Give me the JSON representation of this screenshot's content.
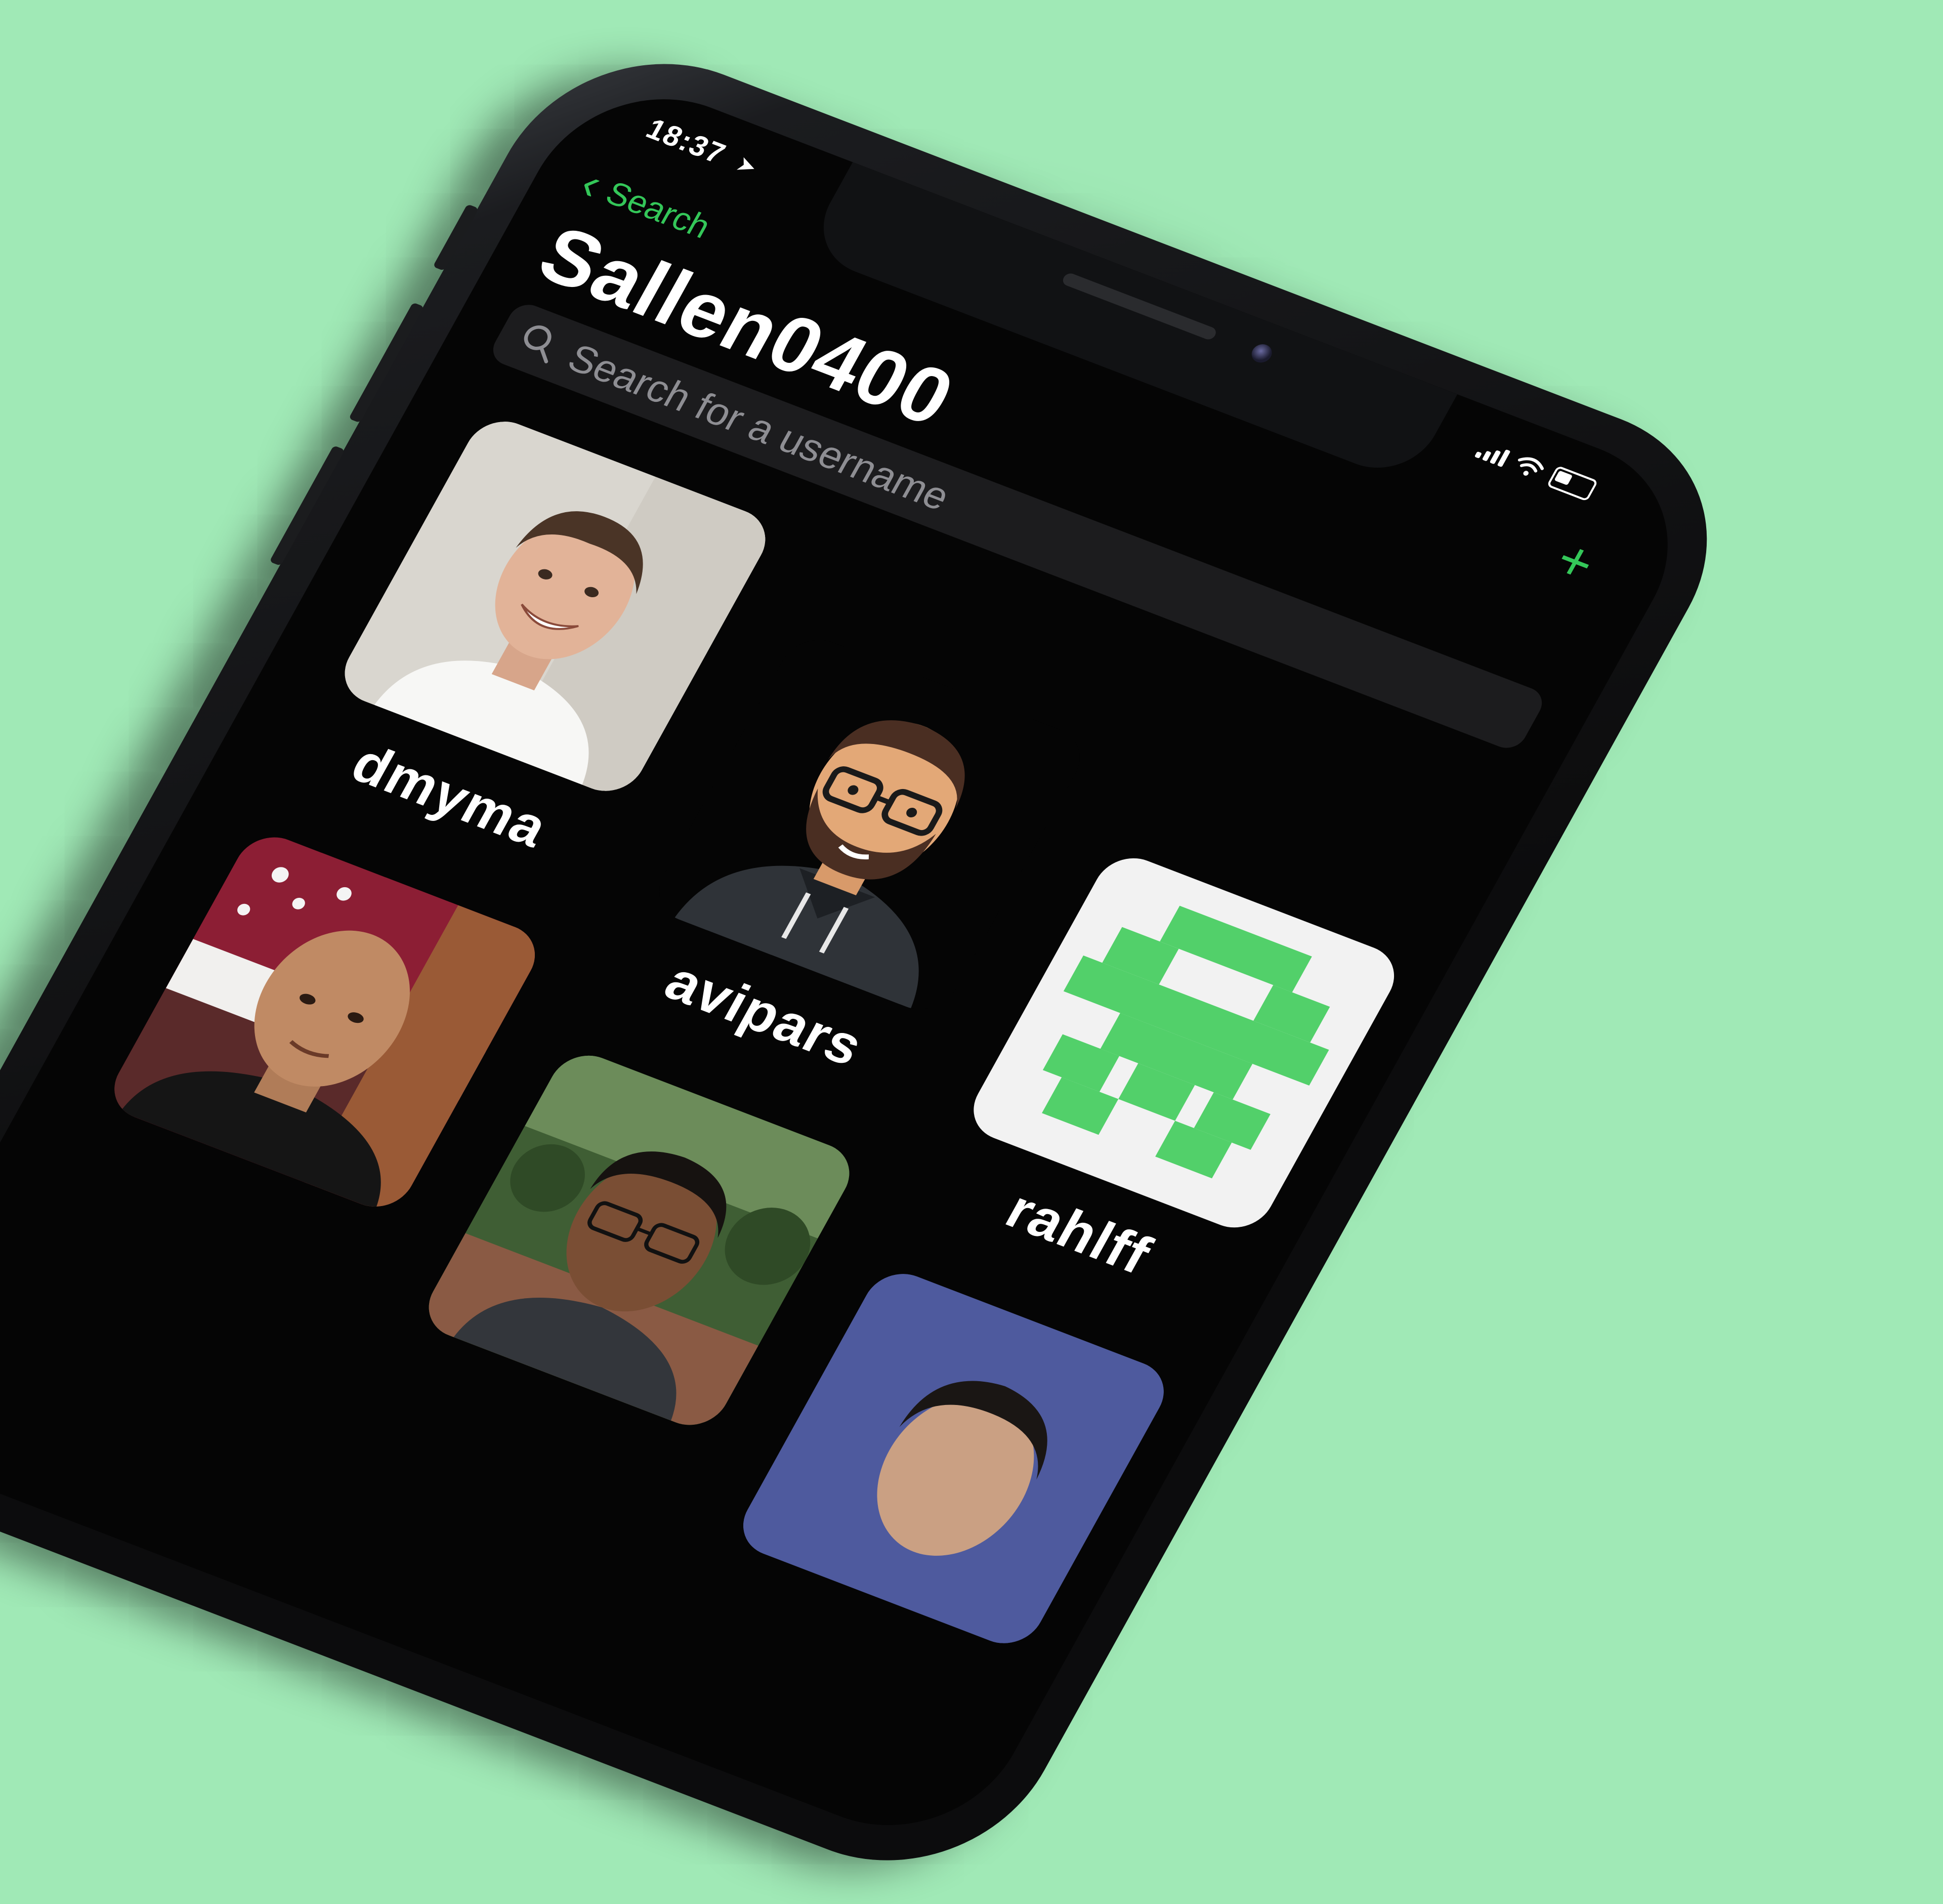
{
  "status_bar": {
    "time": "18:37",
    "location_icon": "location-arrow-icon"
  },
  "nav": {
    "back_label": "Search",
    "add_icon": "plus-icon"
  },
  "page": {
    "title": "Sallen0400"
  },
  "search": {
    "placeholder": "Search for a username"
  },
  "users": [
    {
      "username": "dmyma"
    },
    {
      "username": "avipars"
    },
    {
      "username": "rahlff"
    },
    {
      "username": ""
    },
    {
      "username": ""
    },
    {
      "username": ""
    }
  ],
  "colors": {
    "accent": "#34c759",
    "background": "#a0e9b6",
    "screen": "#050505",
    "rahlff_tile": "#f2f2f2",
    "rahlff_pattern": "#52d06a"
  }
}
